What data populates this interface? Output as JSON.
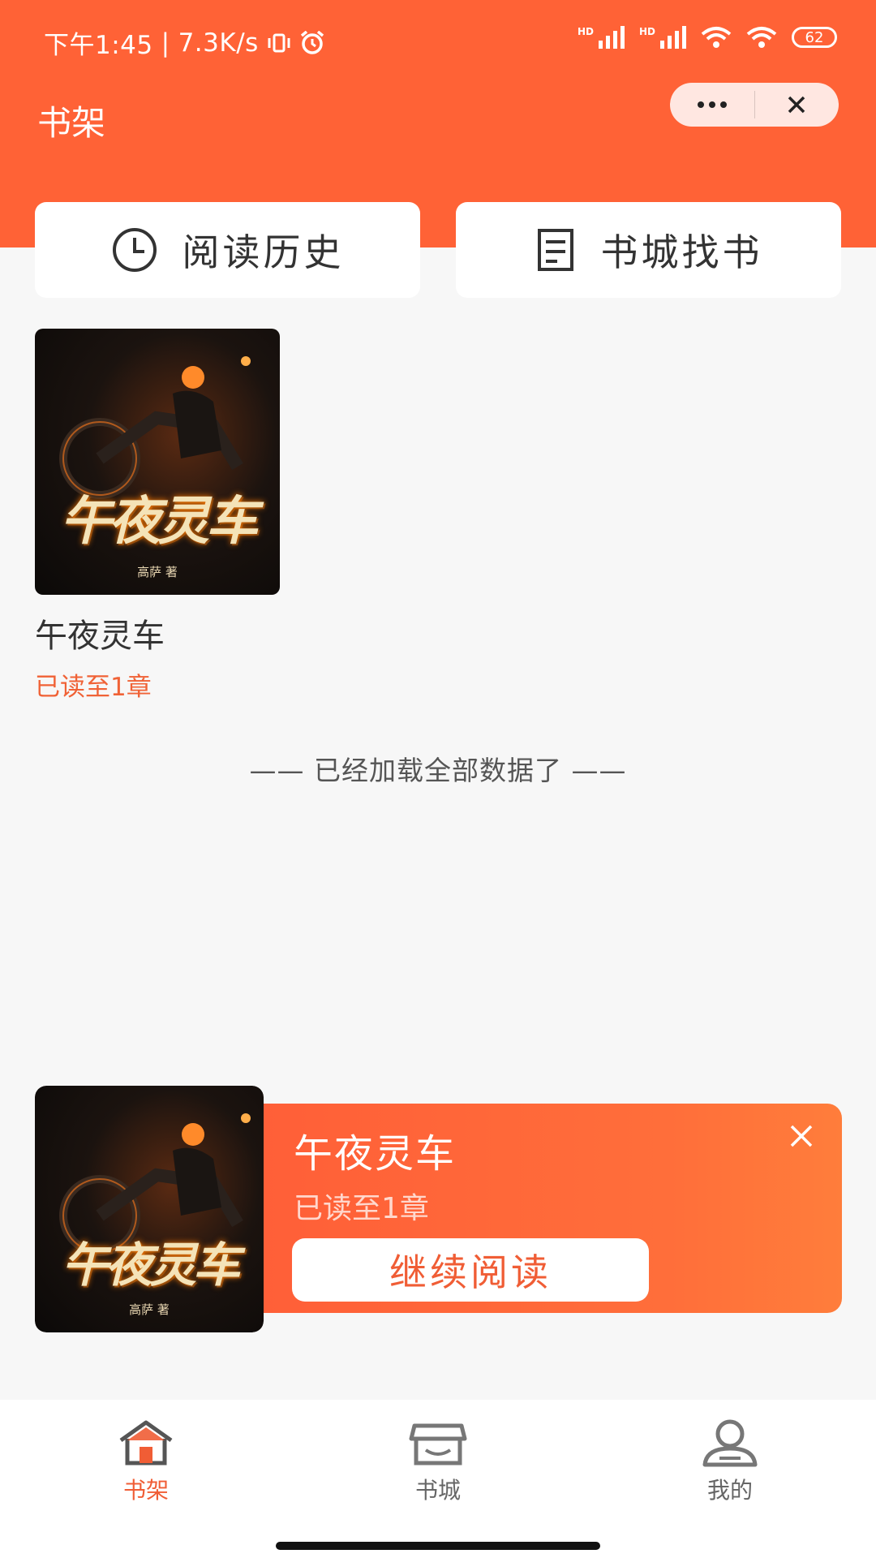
{
  "status_bar": {
    "time": "下午1:45",
    "net_speed": "7.3K/s",
    "battery": "62"
  },
  "header": {
    "title": "书架"
  },
  "quick_actions": [
    {
      "label": "阅读历史",
      "icon": "clock-icon"
    },
    {
      "label": "书城找书",
      "icon": "document-icon"
    }
  ],
  "bookshelf": {
    "books": [
      {
        "title": "午夜灵车",
        "cover_title": "午夜灵车",
        "cover_author": "高萨 著",
        "progress": "已读至1章"
      }
    ],
    "end_message": "—— 已经加载全部数据了 ——"
  },
  "continue_reading": {
    "title": "午夜灵车",
    "cover_title": "午夜灵车",
    "cover_author": "高萨 著",
    "progress": "已读至1章",
    "button_label": "继续阅读"
  },
  "tabbar": {
    "items": [
      {
        "label": "书架",
        "icon": "home-icon",
        "active": true
      },
      {
        "label": "书城",
        "icon": "store-icon",
        "active": false
      },
      {
        "label": "我的",
        "icon": "user-icon",
        "active": false
      }
    ]
  },
  "colors": {
    "primary": "#ff6236",
    "accent_text": "#f05d35",
    "background": "#f7f7f7"
  }
}
